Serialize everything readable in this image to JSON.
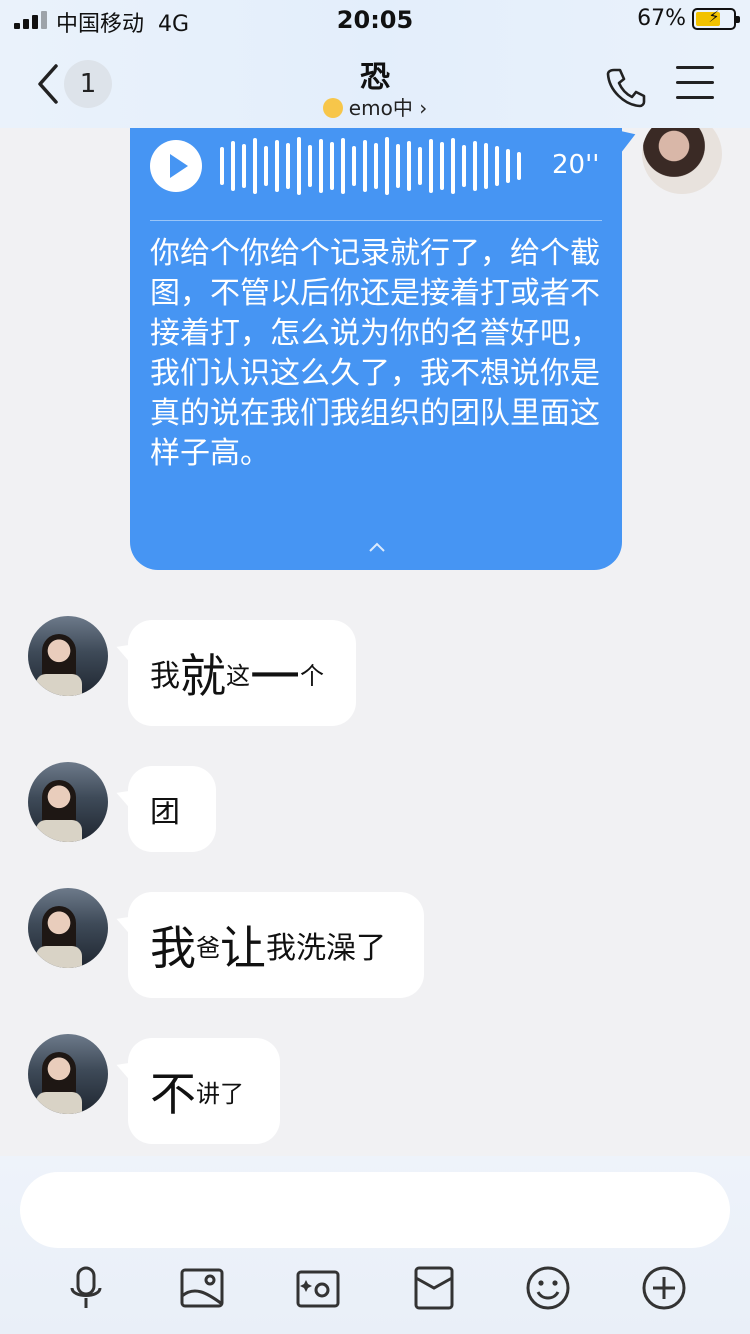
{
  "status_bar": {
    "carrier": "中国移动",
    "network": "4G",
    "time": "20:05",
    "battery_percent": "67%",
    "battery_level": 0.67,
    "charging_icon": "⚡"
  },
  "header": {
    "back_icon": "chevron-left",
    "unread_count": "1",
    "title": "恐",
    "subtitle": "emo中",
    "subtitle_chevron": "›",
    "phone_icon": "phone",
    "menu_icon": "hamburger"
  },
  "voice_message": {
    "duration": "20''",
    "transcript": "你给个你给个记录就行了，给个截图，不管以后你还是接着打或者不接着打，怎么说为你的名誉好吧，我们认识这么久了，我不想说你是真的说在我们我组织的团队里面这样子高。",
    "collapse_icon": "^",
    "accent": "#4695f3"
  },
  "messages": [
    {
      "parts": [
        "我",
        "就",
        "这",
        "一",
        "个"
      ]
    },
    {
      "parts": [
        "团"
      ]
    },
    {
      "parts": [
        "我",
        "爸",
        "让",
        "我洗澡了"
      ]
    },
    {
      "parts": [
        "不",
        "讲了"
      ]
    }
  ],
  "input": {
    "placeholder": "",
    "toolbar": [
      "microphone-icon",
      "image-icon",
      "camera-icon",
      "red-packet-icon",
      "emoji-icon",
      "plus-icon"
    ]
  }
}
